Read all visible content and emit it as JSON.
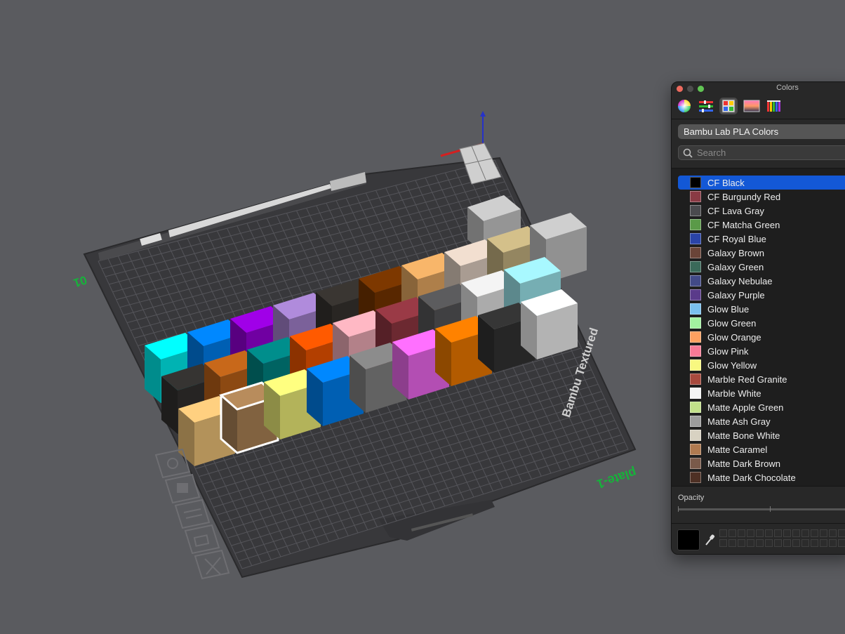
{
  "viewport": {
    "plate_label": "plate-1",
    "plate_type": "Bambu Textured",
    "axis_label": "01",
    "bed_colors": {
      "plate": "#3d3d40",
      "grid": "#58585c",
      "background": "#5a5b5f",
      "axis_label": "#16b33a"
    },
    "left_toolbar": [
      {
        "icon": "orient-icon"
      },
      {
        "icon": "arrange-icon"
      },
      {
        "icon": "plate-settings-icon"
      },
      {
        "icon": "pick-object-icon"
      },
      {
        "icon": "delete-plate-icon"
      }
    ],
    "cubes": [
      {
        "color": "#00ffff"
      },
      {
        "color": "#0088ff"
      },
      {
        "color": "#a000e8"
      },
      {
        "color": "#b08bdc"
      },
      {
        "color": "#3a3632"
      },
      {
        "color": "#7d3800"
      },
      {
        "color": "#f8b66a"
      },
      {
        "color": "#f2dfd0"
      },
      {
        "color": "#d4c08a"
      },
      {
        "color": "#cfcfcf"
      },
      {
        "color": "#363432"
      },
      {
        "color": "#c8681a"
      },
      {
        "color": "#008e8c"
      },
      {
        "color": "#ff5a00"
      },
      {
        "color": "#ffb8c4"
      },
      {
        "color": "#9a3a46"
      },
      {
        "color": "#5c5c5e"
      },
      {
        "color": "#f4f4f4"
      },
      {
        "color": "#a8f8ff"
      },
      {
        "color": "#ffd080"
      },
      {
        "color": "#b88c5c"
      },
      {
        "color": "#ffff80"
      },
      {
        "color": "#0088ff"
      },
      {
        "color": "#8c8c8c"
      },
      {
        "color": "#ff70ff"
      },
      {
        "color": "#ff8200"
      },
      {
        "color": "#363636"
      },
      {
        "color": "#ffffff"
      }
    ]
  },
  "colors_panel": {
    "title": "Colors",
    "list_name": "Bambu Lab PLA Colors",
    "search_placeholder": "Search",
    "opacity_label": "Opacity",
    "current_color": "#000000",
    "tabs": [
      {
        "icon": "color-wheel-icon",
        "selected": false
      },
      {
        "icon": "color-sliders-icon",
        "selected": false
      },
      {
        "icon": "color-palettes-icon",
        "selected": true
      },
      {
        "icon": "image-palettes-icon",
        "selected": false
      },
      {
        "icon": "pencils-icon",
        "selected": false
      }
    ],
    "items": [
      {
        "name": "CF Black",
        "color": "#000000",
        "selected": true
      },
      {
        "name": "CF Burgundy Red",
        "color": "#8a3a44"
      },
      {
        "name": "CF Lava Gray",
        "color": "#4a4a4e"
      },
      {
        "name": "CF Matcha Green",
        "color": "#5a9a48"
      },
      {
        "name": "CF Royal Blue",
        "color": "#2a44a8"
      },
      {
        "name": "Galaxy Brown",
        "color": "#6a4438"
      },
      {
        "name": "Galaxy Green",
        "color": "#3a6a5a"
      },
      {
        "name": "Galaxy Nebulae",
        "color": "#424a88"
      },
      {
        "name": "Galaxy Purple",
        "color": "#5a3a8a"
      },
      {
        "name": "Glow Blue",
        "color": "#7ac0ee"
      },
      {
        "name": "Glow Green",
        "color": "#a2f2a0"
      },
      {
        "name": "Glow Orange",
        "color": "#ffa060"
      },
      {
        "name": "Glow Pink",
        "color": "#f87a96"
      },
      {
        "name": "Glow Yellow",
        "color": "#f8f880"
      },
      {
        "name": "Marble Red Granite",
        "color": "#a84a3e"
      },
      {
        "name": "Marble White",
        "color": "#f4f4f4"
      },
      {
        "name": "Matte Apple Green",
        "color": "#c2e08a"
      },
      {
        "name": "Matte Ash Gray",
        "color": "#9c9c9c"
      },
      {
        "name": "Matte Bone White",
        "color": "#d8d2c2"
      },
      {
        "name": "Matte Caramel",
        "color": "#b07a50"
      },
      {
        "name": "Matte Dark Brown",
        "color": "#7a5a4a"
      },
      {
        "name": "Matte Dark Chocolate",
        "color": "#4e3024"
      }
    ]
  }
}
